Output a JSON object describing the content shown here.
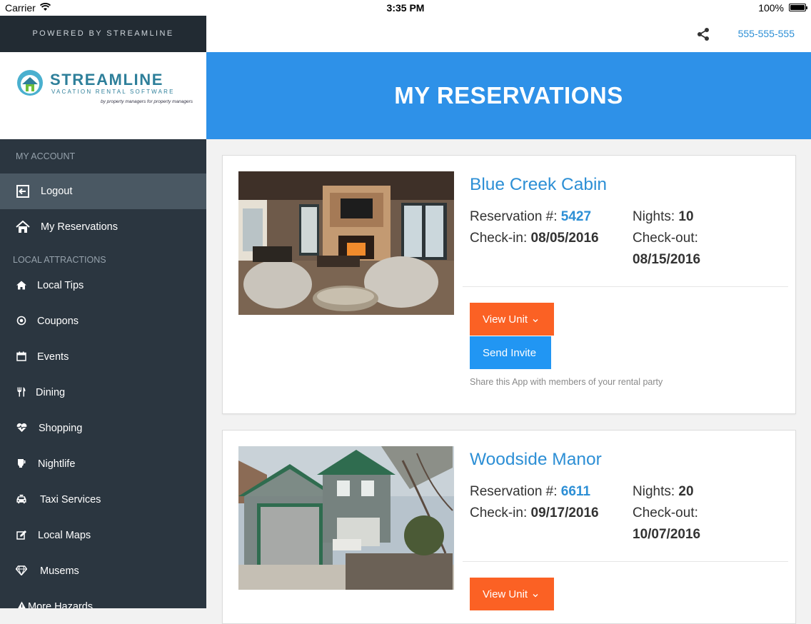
{
  "status_bar": {
    "carrier": "Carrier",
    "time": "3:35 PM",
    "battery": "100%"
  },
  "sidebar": {
    "powered_by": "POWERED BY STREAMLINE",
    "logo": {
      "name": "STREAMLINE",
      "subtitle": "VACATION RENTAL SOFTWARE",
      "tagline": "by property managers for property managers"
    },
    "account_section": "MY ACCOUNT",
    "account_items": [
      {
        "label": "Logout",
        "icon": "logout-icon",
        "active": true
      },
      {
        "label": "My Reservations",
        "icon": "home-icon"
      }
    ],
    "attractions_section": "LOCAL ATTRACTIONS",
    "attraction_items": [
      {
        "label": "Local Tips",
        "icon": "home-icon"
      },
      {
        "label": "Coupons",
        "icon": "target-icon"
      },
      {
        "label": "Events",
        "icon": "calendar-icon"
      },
      {
        "label": "Dining",
        "icon": "fork-knife-icon"
      },
      {
        "label": "Shopping",
        "icon": "heart-pulse-icon"
      },
      {
        "label": "Nightlife",
        "icon": "glass-icon"
      },
      {
        "label": "Taxi Services",
        "icon": "taxi-icon"
      },
      {
        "label": "Local Maps",
        "icon": "edit-map-icon"
      },
      {
        "label": "Musems",
        "icon": "diamond-icon"
      },
      {
        "label": "More Hazards",
        "icon": "warning-icon"
      }
    ]
  },
  "header": {
    "phone": "555-555-555",
    "share_icon": "share-icon"
  },
  "hero": {
    "title": "MY RESERVATIONS"
  },
  "reservations": [
    {
      "name": "Blue Creek Cabin",
      "reservation_label": "Reservation #:",
      "reservation_number": "5427",
      "nights_label": "Nights:",
      "nights": "10",
      "checkin_label": "Check-in:",
      "checkin": "08/05/2016",
      "checkout_label": "Check-out:",
      "checkout": "08/15/2016",
      "view_unit_label": "View Unit",
      "send_invite_label": "Send Invite",
      "share_hint": "Share this App with members of your rental party"
    },
    {
      "name": "Woodside Manor",
      "reservation_label": "Reservation #:",
      "reservation_number": "6611",
      "nights_label": "Nights:",
      "nights": "20",
      "checkin_label": "Check-in:",
      "checkin": "09/17/2016",
      "checkout_label": "Check-out:",
      "checkout": "10/07/2016",
      "view_unit_label": "View Unit"
    }
  ],
  "colors": {
    "accent_blue": "#2e91e8",
    "link_blue": "#2d8fd5",
    "orange": "#fb6124",
    "sidebar_bg": "#2b3640"
  }
}
